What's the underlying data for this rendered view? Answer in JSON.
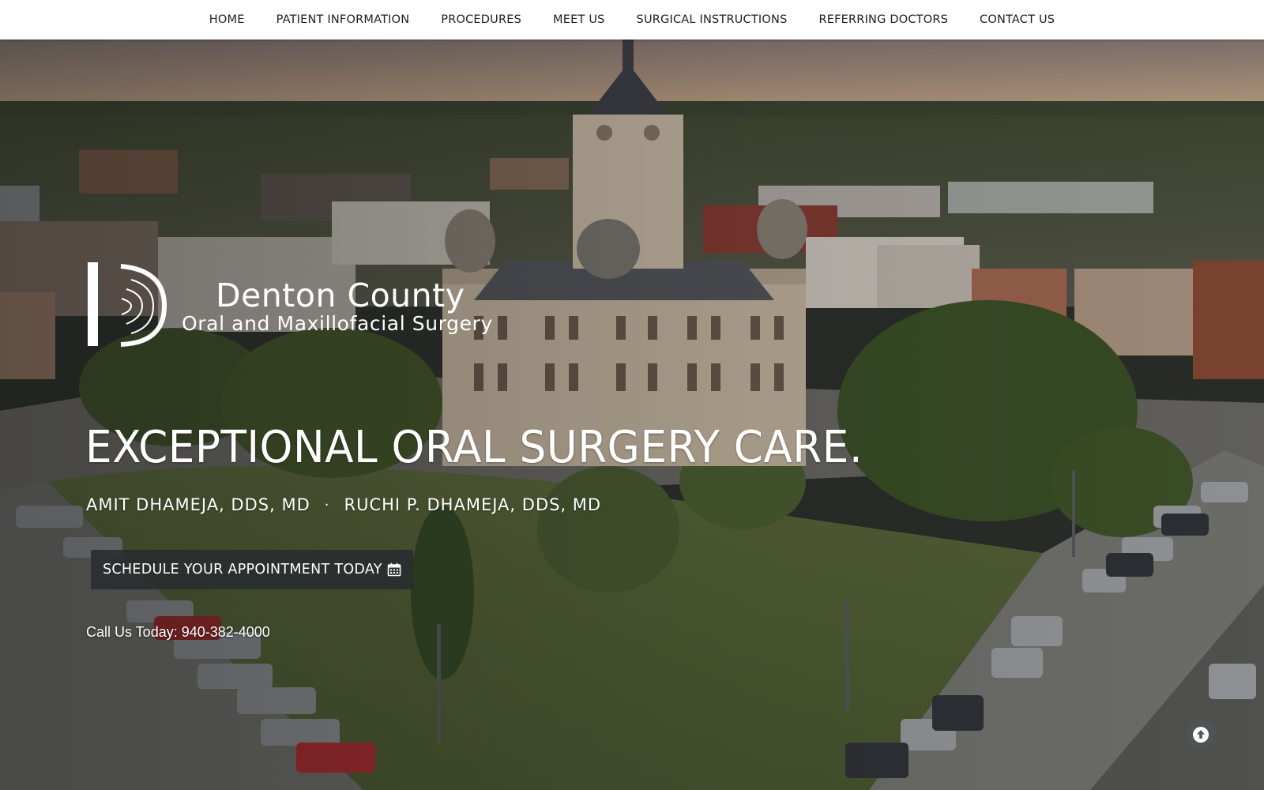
{
  "nav": {
    "items": [
      {
        "label": "HOME"
      },
      {
        "label": "PATIENT INFORMATION"
      },
      {
        "label": "PROCEDURES"
      },
      {
        "label": "MEET US"
      },
      {
        "label": "SURGICAL INSTRUCTIONS"
      },
      {
        "label": "REFERRING DOCTORS"
      },
      {
        "label": "CONTACT US"
      }
    ]
  },
  "brand": {
    "name": "Denton County",
    "subtitle": "Oral and Maxillofacial Surgery"
  },
  "hero": {
    "headline": "EXCEPTIONAL ORAL SURGERY CARE.",
    "doctor_1": "AMIT DHAMEJA, DDS, MD",
    "separator": "·",
    "doctor_2": "RUCHI P. DHAMEJA, DDS, MD",
    "cta_label": "SCHEDULE YOUR APPOINTMENT TODAY",
    "cta_icon": "calendar-icon",
    "phone_text": "Call Us Today: 940-382-4000"
  },
  "scroll_top": {
    "icon": "arrow-up-circle-icon"
  },
  "colors": {
    "nav_bg": "#ffffff",
    "nav_text": "#1e1e1e",
    "cta_bg": "#282c2f",
    "hero_text": "#ffffff"
  }
}
